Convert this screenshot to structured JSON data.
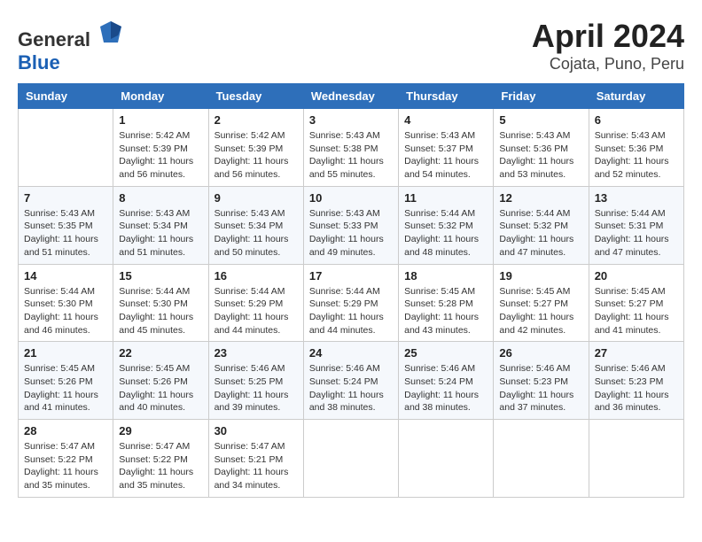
{
  "header": {
    "logo_general": "General",
    "logo_blue": "Blue",
    "month": "April 2024",
    "location": "Cojata, Puno, Peru"
  },
  "weekdays": [
    "Sunday",
    "Monday",
    "Tuesday",
    "Wednesday",
    "Thursday",
    "Friday",
    "Saturday"
  ],
  "weeks": [
    [
      {
        "day": "",
        "info": ""
      },
      {
        "day": "1",
        "info": "Sunrise: 5:42 AM\nSunset: 5:39 PM\nDaylight: 11 hours\nand 56 minutes."
      },
      {
        "day": "2",
        "info": "Sunrise: 5:42 AM\nSunset: 5:39 PM\nDaylight: 11 hours\nand 56 minutes."
      },
      {
        "day": "3",
        "info": "Sunrise: 5:43 AM\nSunset: 5:38 PM\nDaylight: 11 hours\nand 55 minutes."
      },
      {
        "day": "4",
        "info": "Sunrise: 5:43 AM\nSunset: 5:37 PM\nDaylight: 11 hours\nand 54 minutes."
      },
      {
        "day": "5",
        "info": "Sunrise: 5:43 AM\nSunset: 5:36 PM\nDaylight: 11 hours\nand 53 minutes."
      },
      {
        "day": "6",
        "info": "Sunrise: 5:43 AM\nSunset: 5:36 PM\nDaylight: 11 hours\nand 52 minutes."
      }
    ],
    [
      {
        "day": "7",
        "info": "Sunrise: 5:43 AM\nSunset: 5:35 PM\nDaylight: 11 hours\nand 51 minutes."
      },
      {
        "day": "8",
        "info": "Sunrise: 5:43 AM\nSunset: 5:34 PM\nDaylight: 11 hours\nand 51 minutes."
      },
      {
        "day": "9",
        "info": "Sunrise: 5:43 AM\nSunset: 5:34 PM\nDaylight: 11 hours\nand 50 minutes."
      },
      {
        "day": "10",
        "info": "Sunrise: 5:43 AM\nSunset: 5:33 PM\nDaylight: 11 hours\nand 49 minutes."
      },
      {
        "day": "11",
        "info": "Sunrise: 5:44 AM\nSunset: 5:32 PM\nDaylight: 11 hours\nand 48 minutes."
      },
      {
        "day": "12",
        "info": "Sunrise: 5:44 AM\nSunset: 5:32 PM\nDaylight: 11 hours\nand 47 minutes."
      },
      {
        "day": "13",
        "info": "Sunrise: 5:44 AM\nSunset: 5:31 PM\nDaylight: 11 hours\nand 47 minutes."
      }
    ],
    [
      {
        "day": "14",
        "info": "Sunrise: 5:44 AM\nSunset: 5:30 PM\nDaylight: 11 hours\nand 46 minutes."
      },
      {
        "day": "15",
        "info": "Sunrise: 5:44 AM\nSunset: 5:30 PM\nDaylight: 11 hours\nand 45 minutes."
      },
      {
        "day": "16",
        "info": "Sunrise: 5:44 AM\nSunset: 5:29 PM\nDaylight: 11 hours\nand 44 minutes."
      },
      {
        "day": "17",
        "info": "Sunrise: 5:44 AM\nSunset: 5:29 PM\nDaylight: 11 hours\nand 44 minutes."
      },
      {
        "day": "18",
        "info": "Sunrise: 5:45 AM\nSunset: 5:28 PM\nDaylight: 11 hours\nand 43 minutes."
      },
      {
        "day": "19",
        "info": "Sunrise: 5:45 AM\nSunset: 5:27 PM\nDaylight: 11 hours\nand 42 minutes."
      },
      {
        "day": "20",
        "info": "Sunrise: 5:45 AM\nSunset: 5:27 PM\nDaylight: 11 hours\nand 41 minutes."
      }
    ],
    [
      {
        "day": "21",
        "info": "Sunrise: 5:45 AM\nSunset: 5:26 PM\nDaylight: 11 hours\nand 41 minutes."
      },
      {
        "day": "22",
        "info": "Sunrise: 5:45 AM\nSunset: 5:26 PM\nDaylight: 11 hours\nand 40 minutes."
      },
      {
        "day": "23",
        "info": "Sunrise: 5:46 AM\nSunset: 5:25 PM\nDaylight: 11 hours\nand 39 minutes."
      },
      {
        "day": "24",
        "info": "Sunrise: 5:46 AM\nSunset: 5:24 PM\nDaylight: 11 hours\nand 38 minutes."
      },
      {
        "day": "25",
        "info": "Sunrise: 5:46 AM\nSunset: 5:24 PM\nDaylight: 11 hours\nand 38 minutes."
      },
      {
        "day": "26",
        "info": "Sunrise: 5:46 AM\nSunset: 5:23 PM\nDaylight: 11 hours\nand 37 minutes."
      },
      {
        "day": "27",
        "info": "Sunrise: 5:46 AM\nSunset: 5:23 PM\nDaylight: 11 hours\nand 36 minutes."
      }
    ],
    [
      {
        "day": "28",
        "info": "Sunrise: 5:47 AM\nSunset: 5:22 PM\nDaylight: 11 hours\nand 35 minutes."
      },
      {
        "day": "29",
        "info": "Sunrise: 5:47 AM\nSunset: 5:22 PM\nDaylight: 11 hours\nand 35 minutes."
      },
      {
        "day": "30",
        "info": "Sunrise: 5:47 AM\nSunset: 5:21 PM\nDaylight: 11 hours\nand 34 minutes."
      },
      {
        "day": "",
        "info": ""
      },
      {
        "day": "",
        "info": ""
      },
      {
        "day": "",
        "info": ""
      },
      {
        "day": "",
        "info": ""
      }
    ]
  ]
}
